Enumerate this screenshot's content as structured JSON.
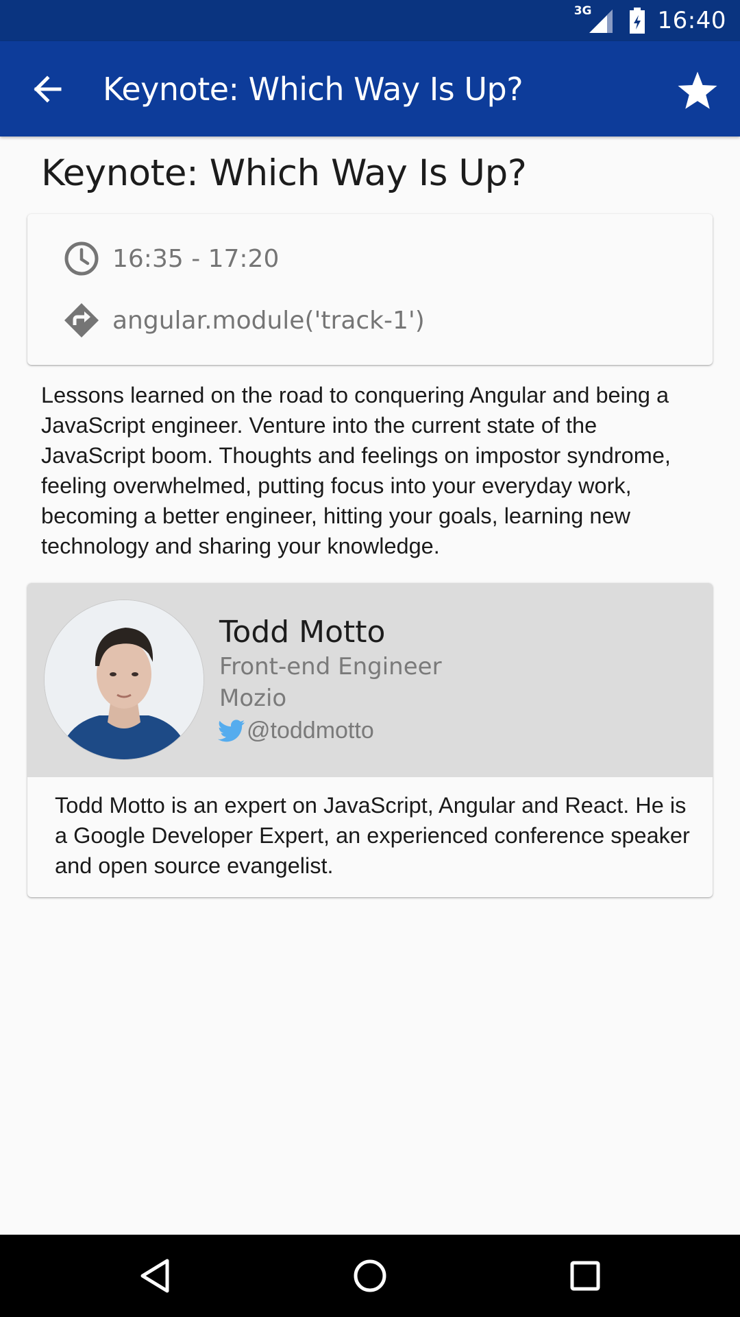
{
  "status_bar": {
    "network": "3G",
    "time": "16:40"
  },
  "app_bar": {
    "title": "Keynote: Which Way Is Up?",
    "back_icon": "arrow-left-icon",
    "favorite_icon": "star-icon"
  },
  "session": {
    "title": "Keynote: Which Way Is Up?",
    "time": "16:35 - 17:20",
    "room": "angular.module('track-1')",
    "description": "Lessons learned on the road to conquering Angular and being a JavaScript engineer. Venture into the current state of the JavaScript boom. Thoughts and feelings on impostor syndrome, feeling overwhelmed, putting focus into your everyday work, becoming a better engineer, hitting your goals, learning new technology and sharing your knowledge."
  },
  "speaker": {
    "name": "Todd Motto",
    "role": "Front-end Engineer",
    "company": "Mozio",
    "twitter": "@toddmotto",
    "bio": "Todd Motto is an expert on JavaScript, Angular and React. He is a Google Developer Expert, an experienced conference speaker and open source evangelist."
  },
  "colors": {
    "status_bar": "#0a3480",
    "app_bar": "#0d3c9a",
    "speaker_header": "#dcdcdc",
    "twitter_blue": "#55acee"
  },
  "nav_bar": {
    "back_icon": "triangle-back-icon",
    "home_icon": "circle-home-icon",
    "recents_icon": "square-recents-icon"
  }
}
